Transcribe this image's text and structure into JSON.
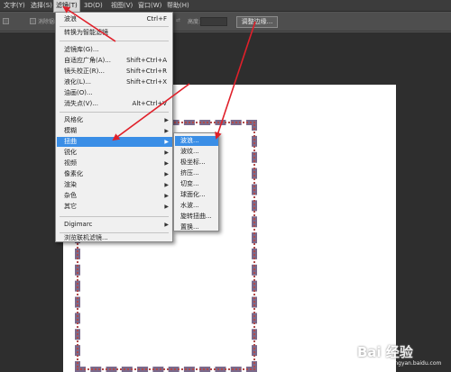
{
  "menubar": {
    "items": [
      {
        "label": "文字(Y)"
      },
      {
        "label": "选择(S)"
      },
      {
        "label": "滤镜(T)"
      },
      {
        "label": "3D(D)"
      },
      {
        "label": "视图(V)"
      },
      {
        "label": "窗口(W)"
      },
      {
        "label": "帮助(H)"
      }
    ]
  },
  "optionsbar": {
    "antialias_label": "消除锯齿",
    "height_label": "高度:",
    "refine_label": "调整边缘..."
  },
  "filter_menu": {
    "items": [
      {
        "label": "波浪",
        "shortcut": "Ctrl+F"
      },
      {
        "label": "转换为智能滤镜",
        "shortcut": ""
      },
      {
        "label": "滤镜库(G)...",
        "shortcut": ""
      },
      {
        "label": "自适应广角(A)...",
        "shortcut": "Shift+Ctrl+A"
      },
      {
        "label": "镜头校正(R)...",
        "shortcut": "Shift+Ctrl+R"
      },
      {
        "label": "液化(L)...",
        "shortcut": "Shift+Ctrl+X"
      },
      {
        "label": "油画(O)...",
        "shortcut": ""
      },
      {
        "label": "消失点(V)...",
        "shortcut": "Alt+Ctrl+V"
      },
      {
        "label": "风格化",
        "shortcut": ""
      },
      {
        "label": "模糊",
        "shortcut": ""
      },
      {
        "label": "扭曲",
        "shortcut": ""
      },
      {
        "label": "锐化",
        "shortcut": ""
      },
      {
        "label": "视频",
        "shortcut": ""
      },
      {
        "label": "像素化",
        "shortcut": ""
      },
      {
        "label": "渲染",
        "shortcut": ""
      },
      {
        "label": "杂色",
        "shortcut": ""
      },
      {
        "label": "其它",
        "shortcut": ""
      },
      {
        "label": "Digimarc",
        "shortcut": ""
      },
      {
        "label": "浏览联机滤镜...",
        "shortcut": ""
      }
    ]
  },
  "distort_menu": {
    "items": [
      {
        "label": "波浪..."
      },
      {
        "label": "波纹..."
      },
      {
        "label": "极坐标..."
      },
      {
        "label": "挤压..."
      },
      {
        "label": "切变..."
      },
      {
        "label": "球面化..."
      },
      {
        "label": "水波..."
      },
      {
        "label": "旋转扭曲..."
      },
      {
        "label": "置换..."
      }
    ]
  },
  "colors": {
    "highlight": "#3a8ee6",
    "annotation_arrow": "#e0202a",
    "canvas": "#ffffff",
    "workspace": "#2e2e2e"
  },
  "icons": {
    "submenu": "chevron-right-icon",
    "annotation": "red-arrow-icon"
  },
  "watermark": {
    "brand": "Bai 经验",
    "url": "jingyan.baidu.com"
  }
}
